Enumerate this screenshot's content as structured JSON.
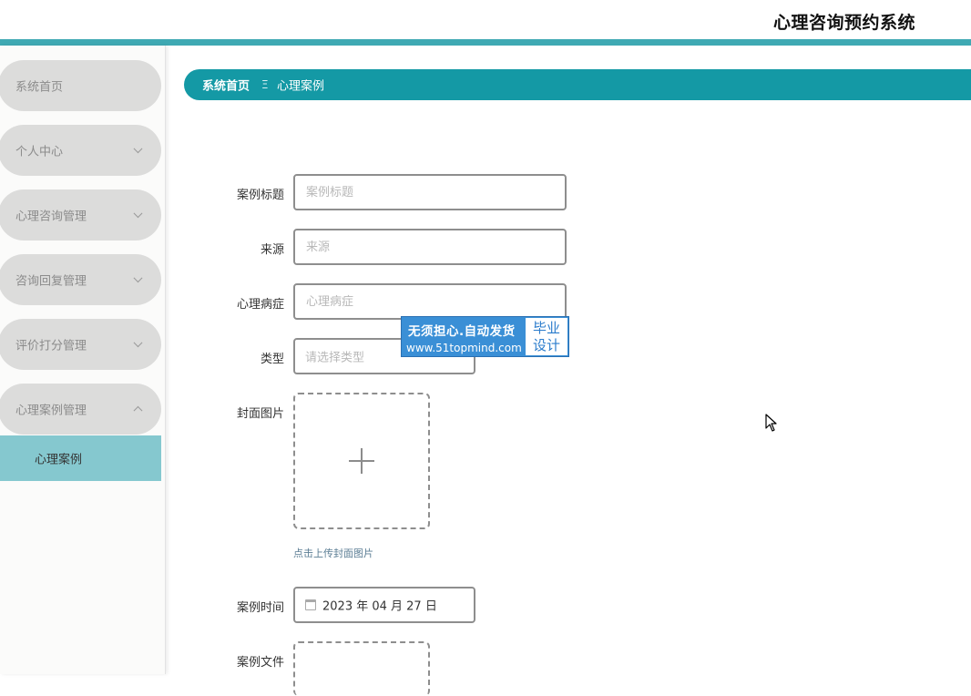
{
  "header": {
    "app_title": "心理咨询预约系统"
  },
  "sidebar": {
    "items": [
      {
        "label": "系统首页"
      },
      {
        "label": "个人中心"
      },
      {
        "label": "心理咨询管理"
      },
      {
        "label": "咨询回复管理"
      },
      {
        "label": "评价打分管理"
      },
      {
        "label": "心理案例管理"
      }
    ],
    "subitem": {
      "label": "心理案例"
    }
  },
  "breadcrumb": {
    "home": "系统首页",
    "separator": "Ξ",
    "current": "心理案例"
  },
  "form": {
    "title": {
      "label": "案例标题",
      "placeholder": "案例标题"
    },
    "source": {
      "label": "来源",
      "placeholder": "来源"
    },
    "symptom": {
      "label": "心理病症",
      "placeholder": "心理病症"
    },
    "type": {
      "label": "类型",
      "placeholder": "请选择类型"
    },
    "cover": {
      "label": "封面图片",
      "tip": "点击上传封面图片"
    },
    "date": {
      "label": "案例时间",
      "value": "2023 年 04 月 27 日"
    },
    "file": {
      "label": "案例文件"
    }
  },
  "watermark": {
    "line1": "无须担心.自动发货",
    "line2": "www.51topmind.com",
    "badge_line1": "毕业",
    "badge_line2": "设计"
  },
  "colors": {
    "accent": "#1499a5",
    "topline": "#3fa9b3",
    "active_submenu": "#85c8cf",
    "menu_bg": "#dcdcdb"
  }
}
